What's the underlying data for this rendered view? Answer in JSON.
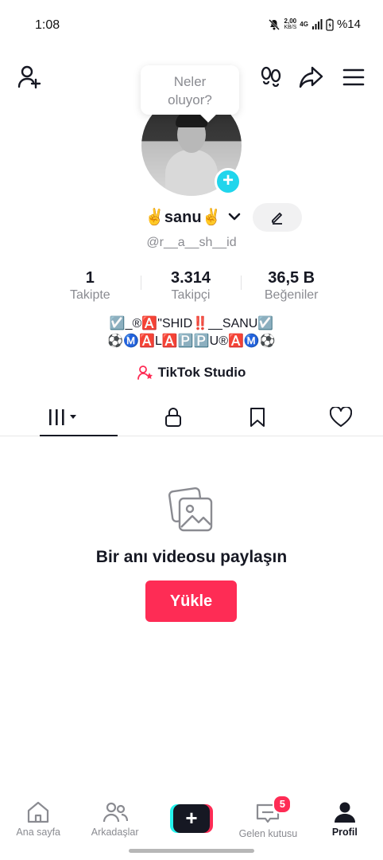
{
  "status": {
    "time": "1:08",
    "speed_value": "2,00",
    "speed_unit": "KB/S",
    "network": "4G",
    "battery": "%14"
  },
  "bubble": {
    "line1": "Neler",
    "line2": "oluyor?"
  },
  "profile": {
    "name": "✌️sanu✌️",
    "username": "@r__a__sh__id",
    "stats": [
      {
        "value": "1",
        "label": "Takipte"
      },
      {
        "value": "3.314",
        "label": "Takipçi"
      },
      {
        "value": "36,5 B",
        "label": "Beğeniler"
      }
    ],
    "bio_line1": "☑️_®🅰️\"SHID‼️__SANU☑️",
    "bio_line2": "⚽Ⓜ️🅰️L🅰️🅿️🅿️U®🅰️Ⓜ️⚽",
    "studio_label": "TikTok Studio"
  },
  "empty": {
    "text": "Bir anı videosu paylaşın",
    "button": "Yükle"
  },
  "nav": {
    "home": "Ana sayfa",
    "friends": "Arkadaşlar",
    "inbox": "Gelen kutusu",
    "inbox_badge": "5",
    "profile": "Profil"
  },
  "colors": {
    "accent": "#fe2c55",
    "cyan": "#25f4ee",
    "text": "#161823",
    "muted": "#8a8b91"
  }
}
